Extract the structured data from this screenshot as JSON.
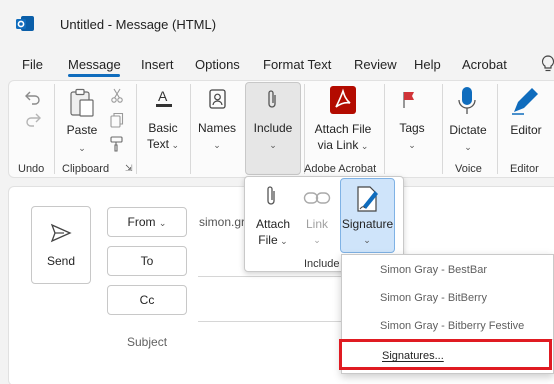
{
  "window": {
    "title": "Untitled  -  Message (HTML)"
  },
  "menu": {
    "items": [
      "File",
      "Message",
      "Insert",
      "Options",
      "Format Text",
      "Review",
      "Help",
      "Acrobat"
    ],
    "active": "Message"
  },
  "ribbon": {
    "undo_group": {
      "label": "Undo"
    },
    "clipboard": {
      "paste": "Paste",
      "label": "Clipboard"
    },
    "basic_text": {
      "line1": "Basic",
      "line2": "Text"
    },
    "names": {
      "label": "Names"
    },
    "include": {
      "label": "Include"
    },
    "attach_link": {
      "line1": "Attach File",
      "line2": "via Link"
    },
    "adobe_acrobat": {
      "label": "Adobe Acrobat"
    },
    "tags": {
      "label": "Tags"
    },
    "dictate": {
      "label": "Dictate"
    },
    "voice": {
      "label": "Voice"
    },
    "editor": {
      "label": "Editor",
      "group": "Editor"
    }
  },
  "include_flyout": {
    "attach_file": {
      "line1": "Attach",
      "line2": "File"
    },
    "link": {
      "label": "Link"
    },
    "signature": {
      "label": "Signature"
    },
    "group": "Include"
  },
  "compose": {
    "send": "Send",
    "from": "From",
    "to": "To",
    "cc": "Cc",
    "subject": "Subject",
    "from_value": "simon.gr"
  },
  "signature_menu": {
    "items": [
      "Simon Gray - BestBar",
      "Simon Gray - BitBerry",
      "Simon Gray - Bitberry Festive"
    ],
    "signatures": "Signatures..."
  },
  "colors": {
    "accent": "#0f6cbd",
    "highlight": "#e01b22",
    "acrobat_red": "#b30b00"
  }
}
